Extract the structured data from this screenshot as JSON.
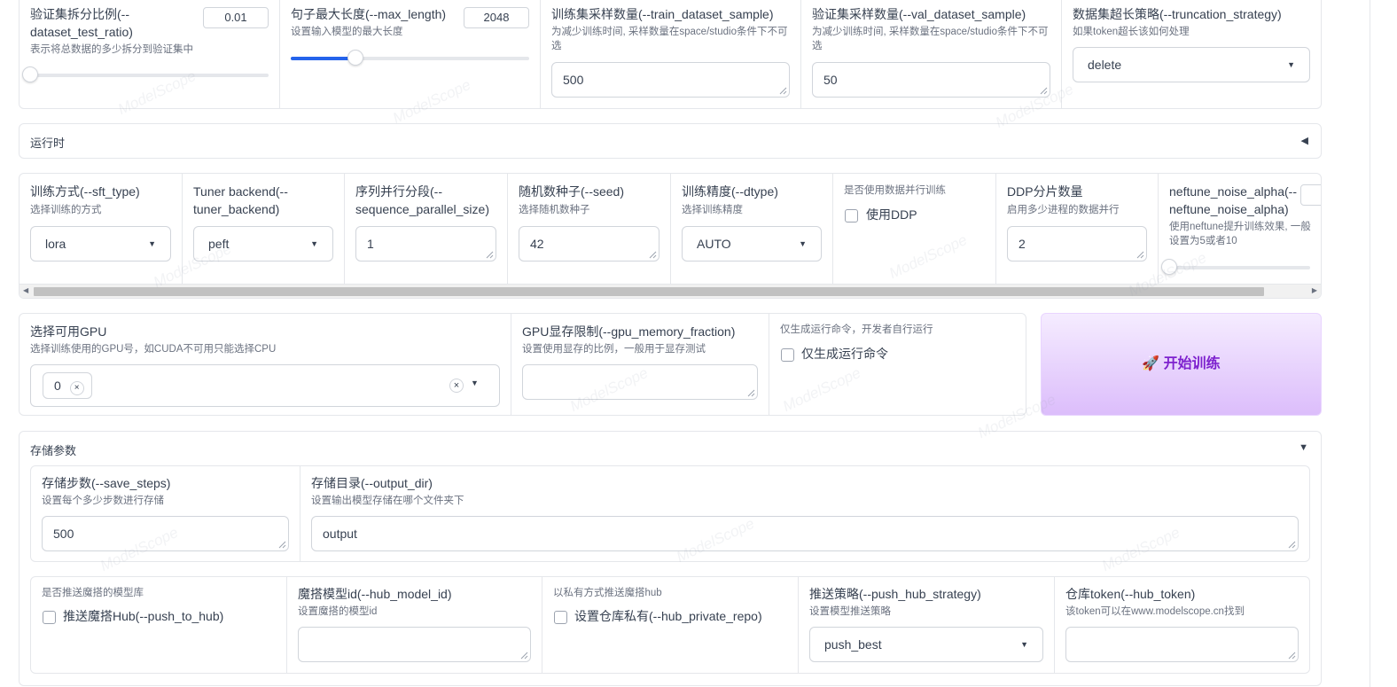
{
  "dataset_row": {
    "test_ratio": {
      "label": "验证集拆分比例(--dataset_test_ratio)",
      "info": "表示将总数据的多少拆分到验证集中",
      "value": "0.01",
      "fraction": 0.0
    },
    "max_length": {
      "label": "句子最大长度(--max_length)",
      "info": "设置输入模型的最大长度",
      "value": "2048",
      "fraction": 0.27
    },
    "train_sample": {
      "label": "训练集采样数量(--train_dataset_sample)",
      "info": "为减少训练时间, 采样数量在space/studio条件下不可选",
      "value": "500"
    },
    "val_sample": {
      "label": "验证集采样数量(--val_dataset_sample)",
      "info": "为减少训练时间, 采样数量在space/studio条件下不可选",
      "value": "50"
    },
    "truncation": {
      "label": "数据集超长策略(--truncation_strategy)",
      "info": "如果token超长该如何处理",
      "value": "delete"
    }
  },
  "runtime_accordion": {
    "title": "运行时",
    "arrow": "◀"
  },
  "runtime_row": {
    "sft_type": {
      "label": "训练方式(--sft_type)",
      "info": "选择训练的方式",
      "value": "lora"
    },
    "tuner_backend": {
      "label": "Tuner backend(--tuner_backend)",
      "value": "peft"
    },
    "seq_parallel": {
      "label": "序列并行分段(--sequence_parallel_size)",
      "value": "1"
    },
    "seed": {
      "label": "随机数种子(--seed)",
      "info": "选择随机数种子",
      "value": "42"
    },
    "dtype": {
      "label": "训练精度(--dtype)",
      "info": "选择训练精度",
      "value": "AUTO"
    },
    "ddp": {
      "info": "是否使用数据并行训练",
      "checkbox": "使用DDP"
    },
    "ddp_num": {
      "label": "DDP分片数量",
      "info": "启用多少进程的数据并行",
      "value": "2"
    },
    "neftune": {
      "label": "neftune_noise_alpha(--neftune_noise_alpha)",
      "info": "使用neftune提升训练效果, 一般设置为5或者10",
      "fraction": 0.0
    }
  },
  "gpu_row": {
    "gpu": {
      "label": "选择可用GPU",
      "info": "选择训练使用的GPU号，如CUDA不可用只能选择CPU",
      "tag": "0",
      "tag_remove": "×",
      "clear": "×"
    },
    "mem_fraction": {
      "label": "GPU显存限制(--gpu_memory_fraction)",
      "info": "设置使用显存的比例，一般用于显存测试",
      "value": ""
    },
    "dry_run": {
      "info": "仅生成运行命令，开发者自行运行",
      "checkbox": "仅生成运行命令"
    },
    "start_button": {
      "icon": "🚀",
      "label": "开始训练"
    }
  },
  "save_accordion": {
    "title": "存储参数",
    "arrow": "▼"
  },
  "save_row": {
    "save_steps": {
      "label": "存储步数(--save_steps)",
      "info": "设置每个多少步数进行存储",
      "value": "500"
    },
    "output_dir": {
      "label": "存储目录(--output_dir)",
      "info": "设置输出模型存储在哪个文件夹下",
      "value": "output"
    }
  },
  "hub_row": {
    "push_to_hub": {
      "info": "是否推送魔搭的模型库",
      "checkbox": "推送魔搭Hub(--push_to_hub)"
    },
    "hub_model_id": {
      "label": "魔搭模型id(--hub_model_id)",
      "info": "设置魔搭的模型id",
      "value": ""
    },
    "private_repo": {
      "info": "以私有方式推送魔搭hub",
      "checkbox": "设置仓库私有(--hub_private_repo)"
    },
    "push_strategy": {
      "label": "推送策略(--push_hub_strategy)",
      "info": "设置模型推送策略",
      "value": "push_best"
    },
    "hub_token": {
      "label": "仓库token(--hub_token)",
      "info": "该token可以在www.modelscope.cn找到",
      "value": ""
    }
  },
  "watermark": "ModelScope",
  "colors": {
    "accent": "#2563eb",
    "button_text": "#7e22ce",
    "button_bg_top": "#f3e8ff",
    "button_bg_bottom": "#d8b4fe"
  }
}
